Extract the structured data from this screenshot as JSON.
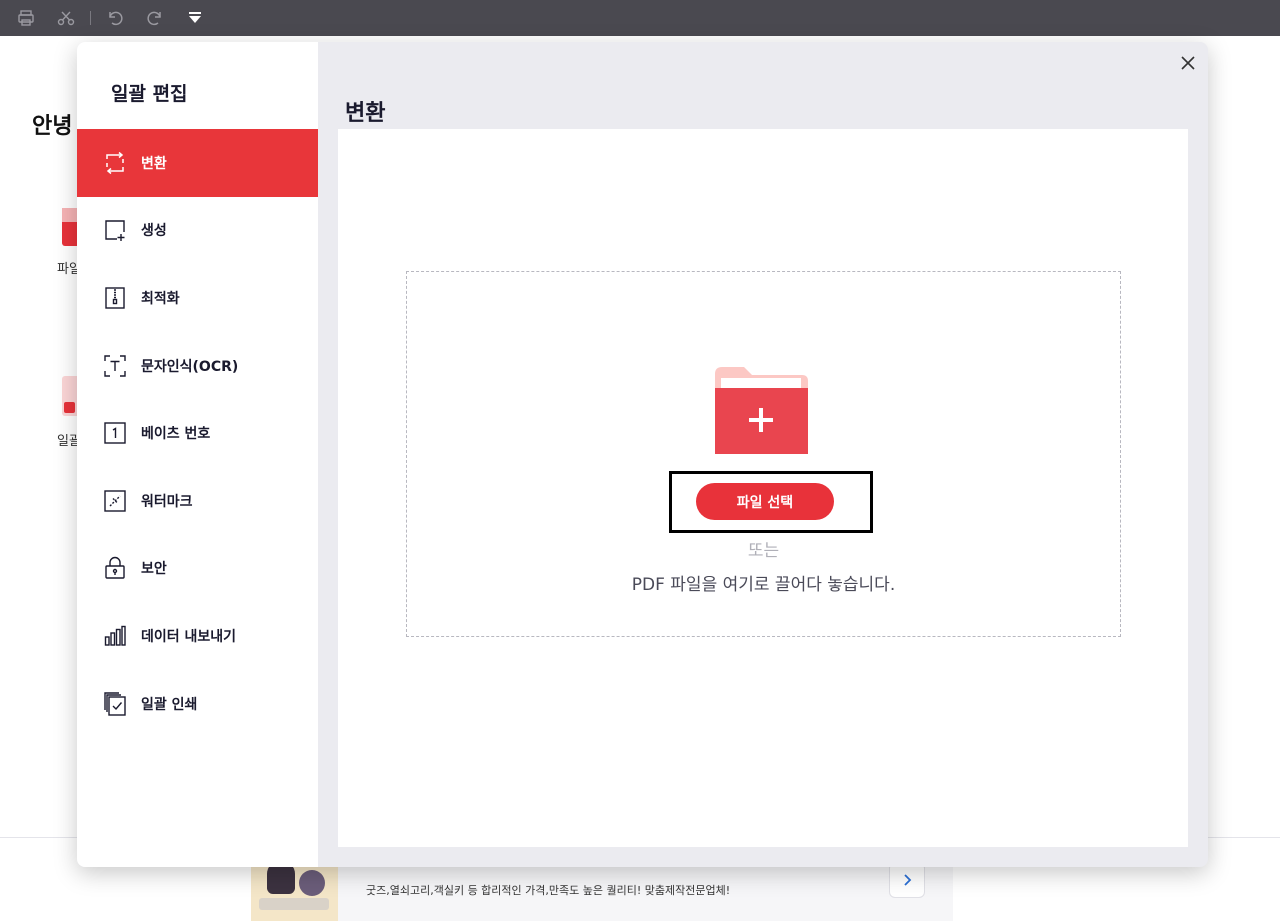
{
  "toolbar": {
    "icons": [
      "print-icon",
      "scissors-icon",
      "undo-icon",
      "redo-icon",
      "dropdown-arrow-icon"
    ]
  },
  "background": {
    "greeting": "안녕",
    "tool1_label": "파일",
    "tool2_label": "일괄",
    "ad_text": "굿즈,열쇠고리,객실키 등 합리적인 가격,만족도 높은 퀄리티! 맞춤제작전문업체!"
  },
  "modal": {
    "title": "일괄 편집",
    "section_title": "변환",
    "menu": [
      {
        "label": "변환",
        "icon": "convert-icon",
        "active": true
      },
      {
        "label": "생성",
        "icon": "create-icon",
        "active": false
      },
      {
        "label": "최적화",
        "icon": "optimize-icon",
        "active": false
      },
      {
        "label": "문자인식(OCR)",
        "icon": "ocr-icon",
        "active": false
      },
      {
        "label": "베이츠 번호",
        "icon": "bates-number-icon",
        "active": false
      },
      {
        "label": "워터마크",
        "icon": "watermark-icon",
        "active": false
      },
      {
        "label": "보안",
        "icon": "lock-icon",
        "active": false
      },
      {
        "label": "데이터 내보내기",
        "icon": "bar-chart-icon",
        "active": false
      },
      {
        "label": "일괄 인쇄",
        "icon": "batch-print-icon",
        "active": false
      }
    ],
    "select_button": "파일 선택",
    "or_text": "또는",
    "drop_text": "PDF 파일을 여기로 끌어다 놓습니다."
  },
  "colors": {
    "accent": "#e8363a",
    "toolbar": "#4a4950",
    "modal_bg": "#ebebf0"
  }
}
